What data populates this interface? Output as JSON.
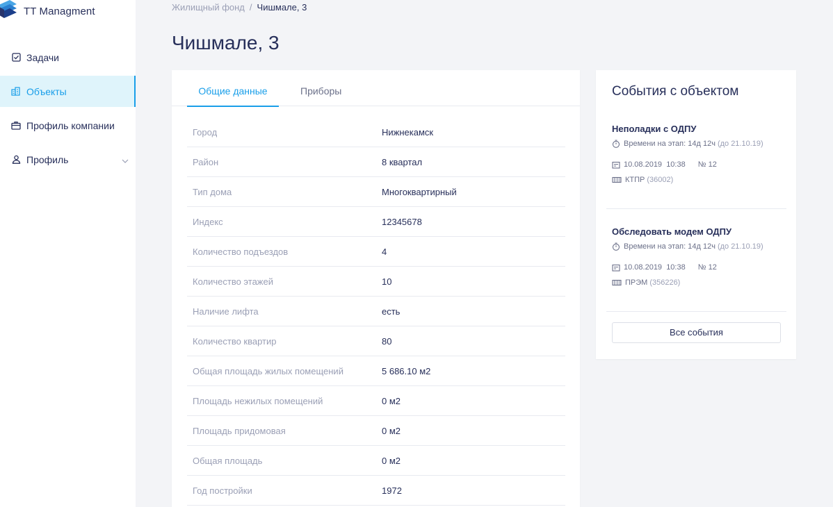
{
  "app": {
    "name": "TT Managment"
  },
  "sidebar": {
    "items": [
      {
        "label": "Задачи",
        "icon": "checkbox-icon"
      },
      {
        "label": "Объекты",
        "icon": "buildings-icon",
        "active": true
      },
      {
        "label": "Профиль компании",
        "icon": "briefcase-icon"
      },
      {
        "label": "Профиль",
        "icon": "user-icon"
      }
    ]
  },
  "breadcrumb": {
    "parent": "Жилищный фонд",
    "separator": "/",
    "current": "Чишмале, 3"
  },
  "page": {
    "title": "Чишмале, 3"
  },
  "tabs": {
    "general": "Общие данные",
    "devices": "Приборы"
  },
  "details": [
    {
      "key": "Город",
      "value": "Нижнекамск"
    },
    {
      "key": "Район",
      "value": "8 квартал"
    },
    {
      "key": "Тип дома",
      "value": "Многоквартирный"
    },
    {
      "key": "Индекс",
      "value": "12345678"
    },
    {
      "key": "Количество подъездов",
      "value": "4"
    },
    {
      "key": "Количество этажей",
      "value": "10"
    },
    {
      "key": "Наличие лифта",
      "value": "есть"
    },
    {
      "key": "Количество квартир",
      "value": "80"
    },
    {
      "key": "Общая площадь жилых помещений",
      "value": "5 686.10 м2"
    },
    {
      "key": "Площадь нежилых помещений",
      "value": "0 м2"
    },
    {
      "key": "Площадь придомовая",
      "value": "0 м2"
    },
    {
      "key": "Общая площадь",
      "value": "0 м2"
    },
    {
      "key": "Год постройки",
      "value": "1972"
    }
  ],
  "events": {
    "title": "События с объектом",
    "items": [
      {
        "title": "Неполадки с ОДПУ",
        "time_label": "Времени на этап: 14д 12ч",
        "deadline": "(до 21.10.19)",
        "date": "10.08.2019",
        "time": "10:38",
        "number": "№ 12",
        "device": "КТПР",
        "device_code": "(36002)"
      },
      {
        "title": "Обследовать модем ОДПУ",
        "time_label": "Времени на этап: 14д 12ч",
        "deadline": "(до 21.10.19)",
        "date": "10.08.2019",
        "time": "10:38",
        "number": "№ 12",
        "device": "ПРЭМ",
        "device_code": "(356226)"
      }
    ],
    "all_button": "Все события"
  },
  "colors": {
    "accent": "#189ee9",
    "text": "#272f5a",
    "muted": "#9a9fb5",
    "background": "#f3f4f7"
  }
}
